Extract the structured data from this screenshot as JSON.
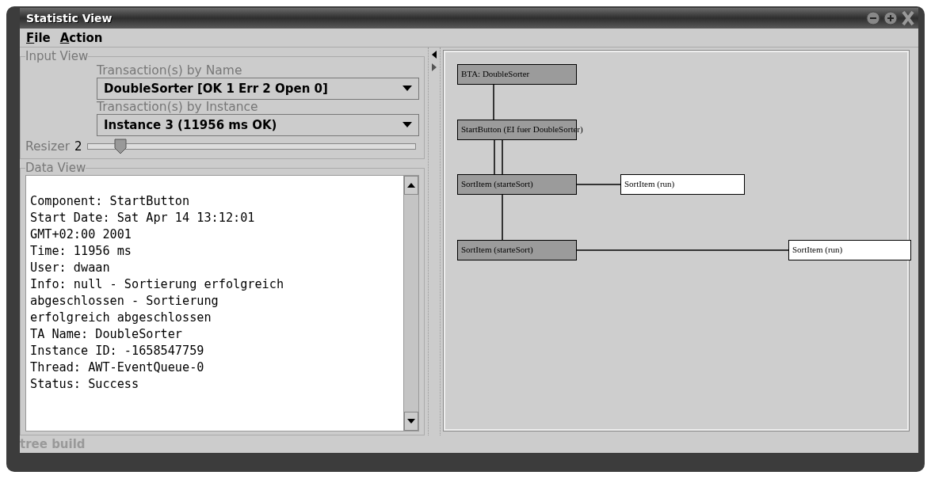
{
  "window": {
    "title": "Statistic View"
  },
  "menu": [
    {
      "label": "File"
    },
    {
      "label": "Action"
    }
  ],
  "input_view": {
    "title": "Input View",
    "by_name": {
      "label": "Transaction(s) by Name",
      "value": "DoubleSorter [OK 1 Err 2 Open 0]"
    },
    "by_instance": {
      "label": "Transaction(s) by Instance",
      "value": "Instance 3 (11956 ms OK)"
    },
    "resizer": {
      "label": "Resizer",
      "value": "2",
      "level": 0.1
    }
  },
  "data_view": {
    "title": "Data View",
    "lines": [
      "Component: StartButton",
      "Start Date: Sat Apr 14 13:12:01",
      "GMT+02:00 2001",
      "Time: 11956 ms",
      "User: dwaan",
      "Info: null - Sortierung erfolgreich",
      "abgeschlossen - Sortierung",
      "erfolgreich abgeschlossen",
      "TA Name: DoubleSorter",
      "Instance ID: -1658547759",
      "Thread: AWT-EventQueue-0",
      "Status: Success"
    ]
  },
  "diagram": {
    "nodes": [
      {
        "label": "BTA: DoubleSorter",
        "kind": "group"
      },
      {
        "label": "StartButton (EI fuer DoubleSorter)",
        "kind": "group"
      },
      {
        "label": "SortItem (starteSort)",
        "kind": "group"
      },
      {
        "label": "SortItem (run)",
        "kind": "leaf"
      },
      {
        "label": "SortItem (starteSort)",
        "kind": "group"
      },
      {
        "label": "SortItem (run)",
        "kind": "leaf"
      }
    ]
  },
  "status_bar": "tree build"
}
